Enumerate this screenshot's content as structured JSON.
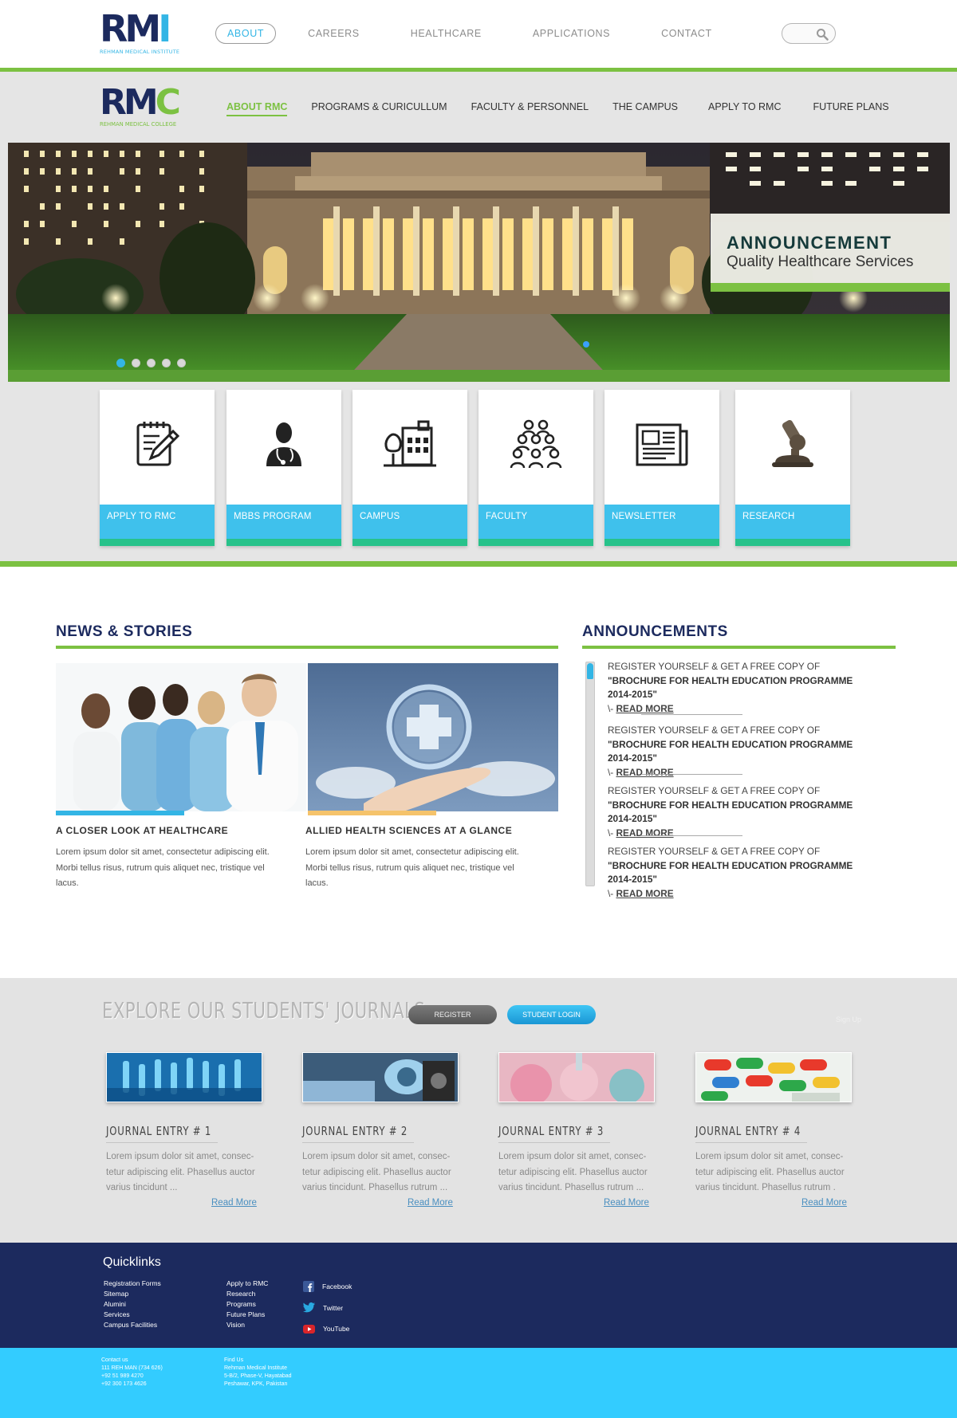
{
  "top": {
    "logo_letters": "RMI",
    "logo_subtitle": "REHMAN MEDICAL INSTITUTE",
    "nav": [
      "ABOUT",
      "CAREERS",
      "HEALTHCARE",
      "APPLICATIONS",
      "CONTACT"
    ],
    "active_nav": "ABOUT",
    "search_icon": "magnifier-icon"
  },
  "college": {
    "logo_letters": "RMC",
    "logo_subtitle": "REHMAN MEDICAL COLLEGE",
    "nav": [
      "ABOUT RMC",
      "PROGRAMS & CURICULLUM",
      "FACULTY & PERSONNEL",
      "THE CAMPUS",
      "APPLY TO RMC",
      "FUTURE PLANS"
    ],
    "active_nav": "ABOUT RMC"
  },
  "hero": {
    "title": "ANNOUNCEMENT",
    "subtitle": "Quality Healthcare Services",
    "slide_count": 5,
    "active_slide": 1
  },
  "cards": [
    {
      "label": "APPLY TO RMC",
      "icon": "notepad-pencil-icon"
    },
    {
      "label": "MBBS PROGRAM",
      "icon": "doctor-icon"
    },
    {
      "label": "CAMPUS",
      "icon": "campus-building-icon"
    },
    {
      "label": "FACULTY",
      "icon": "people-group-icon"
    },
    {
      "label": "NEWSLETTER",
      "icon": "newspaper-icon"
    },
    {
      "label": "RESEARCH",
      "icon": "microscope-icon"
    }
  ],
  "news": {
    "title": "NEWS & STORIES",
    "items": [
      {
        "heading": "A CLOSER LOOK AT HEALTHCARE",
        "text": "Lorem ipsum dolor sit amet, consectetur adipiscing elit. Morbi tellus risus, rutrum quis aliquet nec, tristique vel lacus.",
        "accent": "#33b5e5"
      },
      {
        "heading": "ALLIED HEALTH SCIENCES AT A GLANCE",
        "text": "Lorem ipsum dolor sit amet, consectetur adipiscing elit. Morbi tellus risus, rutrum quis aliquet nec, tristique vel lacus.",
        "accent": "#f5c36b"
      }
    ]
  },
  "announcements": {
    "title": "ANNOUNCEMENTS",
    "items": [
      {
        "prefix": "REGISTER YOURSELF & GET A FREE COPY OF ",
        "bold": "\"BROCHURE FOR HEALTH EDUCATION PROGRAMME 2014-2015\"",
        "more_prefix": "\\- ",
        "more": "READ MORE"
      },
      {
        "prefix": "REGISTER YOURSELF & GET A FREE COPY OF ",
        "bold": "\"BROCHURE FOR HEALTH EDUCATION PROGRAMME 2014-2015\"",
        "more_prefix": "\\- ",
        "more": "READ MORE"
      },
      {
        "prefix": "REGISTER YOURSELF & GET A FREE COPY OF ",
        "bold": "\"BROCHURE FOR HEALTH EDUCATION PROGRAMME 2014-2015\"",
        "more_prefix": "\\- ",
        "more": "READ MORE"
      },
      {
        "prefix": "REGISTER YOURSELF & GET A FREE COPY OF ",
        "bold": "\"BROCHURE FOR HEALTH EDUCATION PROGRAMME 2014-2015\"",
        "more_prefix": "\\- ",
        "more": "READ MORE"
      }
    ]
  },
  "journals": {
    "title": "EXPLORE OUR STUDENTS' JOURNALS",
    "register_label": "REGISTER",
    "login_label": "STUDENT LOGIN",
    "signup_label": "Sign Up",
    "entries": [
      {
        "heading": "JOURNAL ENTRY # 1",
        "text": "Lorem ipsum dolor sit amet, consec-tetur adipiscing elit. Phasellus auctor varius tincidunt ...",
        "more": "Read More"
      },
      {
        "heading": "JOURNAL ENTRY # 2",
        "text": "Lorem ipsum dolor sit amet, consec-tetur adipiscing elit. Phasellus auctor varius tincidunt. Phasellus rutrum ...",
        "more": "Read More"
      },
      {
        "heading": "JOURNAL ENTRY # 3",
        "text": "Lorem ipsum dolor sit amet, consec-tetur adipiscing elit. Phasellus auctor varius tincidunt. Phasellus rutrum ...",
        "more": "Read More"
      },
      {
        "heading": "JOURNAL ENTRY # 4",
        "text": "Lorem ipsum dolor sit amet, consec-tetur adipiscing elit. Phasellus auctor varius tincidunt. Phasellus rutrum .",
        "more": "Read More"
      }
    ]
  },
  "footer": {
    "quicklinks_title": "Quicklinks",
    "col1": [
      "Registration Forms",
      "Sitemap",
      "Alumini",
      "Services",
      "Campus Facilities"
    ],
    "col2": [
      "Apply to RMC",
      "Research",
      "Programs",
      "Future Plans",
      "Vision"
    ],
    "social": [
      {
        "label": "Facebook",
        "icon": "facebook-icon"
      },
      {
        "label": "Twitter",
        "icon": "twitter-icon"
      },
      {
        "label": "YouTube",
        "icon": "youtube-icon"
      }
    ],
    "contact": [
      "Contact us",
      "111 REH MAN (734 626)",
      "+92 51 989 4270",
      "+92 300 173 4626"
    ],
    "find": [
      "Find Us",
      "Rehman Medical Institute",
      "5-B/2, Phase-V, Hayatabad",
      "Peshawar, KPK, Pakistan"
    ]
  },
  "colors": {
    "brand_navy": "#1c2a5e",
    "brand_green": "#7cc142",
    "brand_cyan": "#33b5e5",
    "card_cyan": "#3fc1ec",
    "bottom_cyan": "#33ccff"
  }
}
